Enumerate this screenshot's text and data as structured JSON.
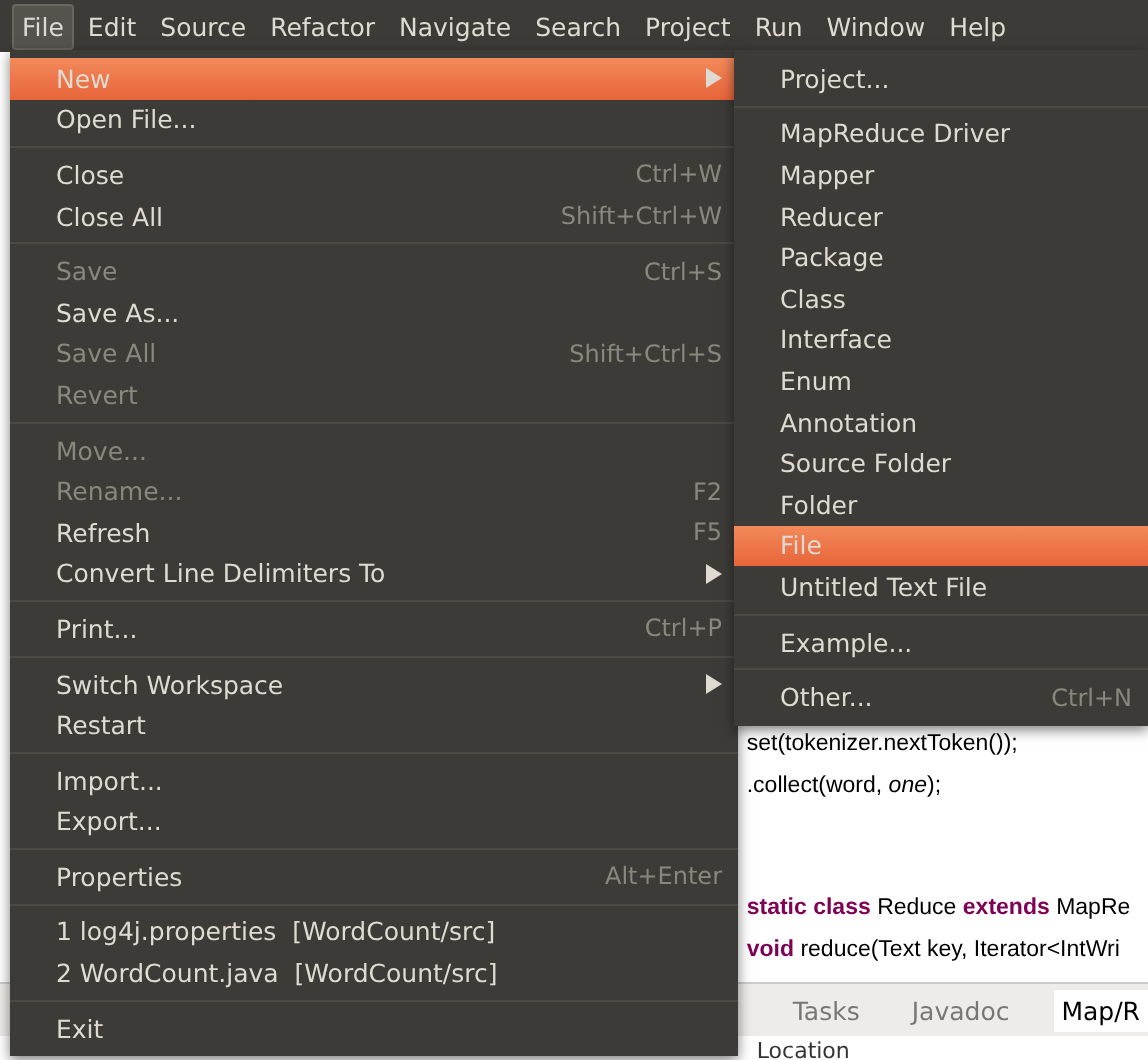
{
  "menubar": [
    {
      "label": "File",
      "selected": true
    },
    {
      "label": "Edit",
      "selected": false
    },
    {
      "label": "Source",
      "selected": false
    },
    {
      "label": "Refactor",
      "selected": false
    },
    {
      "label": "Navigate",
      "selected": false
    },
    {
      "label": "Search",
      "selected": false
    },
    {
      "label": "Project",
      "selected": false
    },
    {
      "label": "Run",
      "selected": false
    },
    {
      "label": "Window",
      "selected": false
    },
    {
      "label": "Help",
      "selected": false
    }
  ],
  "file_menu": [
    {
      "kind": "item",
      "label": "New",
      "selected": true,
      "disabled": false,
      "submenu": true
    },
    {
      "kind": "item",
      "label": "Open File...",
      "selected": false,
      "disabled": false,
      "submenu": false
    },
    {
      "kind": "separator"
    },
    {
      "kind": "item",
      "label": "Close",
      "shortcut": "Ctrl+W",
      "selected": false,
      "disabled": false,
      "submenu": false
    },
    {
      "kind": "item",
      "label": "Close All",
      "shortcut": "Shift+Ctrl+W",
      "selected": false,
      "disabled": false,
      "submenu": false
    },
    {
      "kind": "separator"
    },
    {
      "kind": "item",
      "label": "Save",
      "shortcut": "Ctrl+S",
      "selected": false,
      "disabled": true,
      "submenu": false
    },
    {
      "kind": "item",
      "label": "Save As...",
      "selected": false,
      "disabled": false,
      "submenu": false
    },
    {
      "kind": "item",
      "label": "Save All",
      "shortcut": "Shift+Ctrl+S",
      "selected": false,
      "disabled": true,
      "submenu": false
    },
    {
      "kind": "item",
      "label": "Revert",
      "selected": false,
      "disabled": true,
      "submenu": false
    },
    {
      "kind": "separator"
    },
    {
      "kind": "item",
      "label": "Move...",
      "selected": false,
      "disabled": true,
      "submenu": false
    },
    {
      "kind": "item",
      "label": "Rename...",
      "shortcut": "F2",
      "selected": false,
      "disabled": true,
      "submenu": false
    },
    {
      "kind": "item",
      "label": "Refresh",
      "shortcut": "F5",
      "selected": false,
      "disabled": false,
      "submenu": false
    },
    {
      "kind": "item",
      "label": "Convert Line Delimiters To",
      "selected": false,
      "disabled": false,
      "submenu": true
    },
    {
      "kind": "separator"
    },
    {
      "kind": "item",
      "label": "Print...",
      "shortcut": "Ctrl+P",
      "selected": false,
      "disabled": false,
      "submenu": false
    },
    {
      "kind": "separator"
    },
    {
      "kind": "item",
      "label": "Switch Workspace",
      "selected": false,
      "disabled": false,
      "submenu": true
    },
    {
      "kind": "item",
      "label": "Restart",
      "selected": false,
      "disabled": false,
      "submenu": false
    },
    {
      "kind": "separator"
    },
    {
      "kind": "item",
      "label": "Import...",
      "selected": false,
      "disabled": false,
      "submenu": false
    },
    {
      "kind": "item",
      "label": "Export...",
      "selected": false,
      "disabled": false,
      "submenu": false
    },
    {
      "kind": "separator"
    },
    {
      "kind": "item",
      "label": "Properties",
      "shortcut": "Alt+Enter",
      "selected": false,
      "disabled": false,
      "submenu": false
    },
    {
      "kind": "separator"
    },
    {
      "kind": "item",
      "label": "1 log4j.properties  [WordCount/src]",
      "selected": false,
      "disabled": false,
      "submenu": false
    },
    {
      "kind": "item",
      "label": "2 WordCount.java  [WordCount/src]",
      "selected": false,
      "disabled": false,
      "submenu": false
    },
    {
      "kind": "separator"
    },
    {
      "kind": "item",
      "label": "Exit",
      "selected": false,
      "disabled": false,
      "submenu": false
    }
  ],
  "new_submenu": [
    {
      "kind": "item",
      "label": "Project...",
      "selected": false
    },
    {
      "kind": "separator"
    },
    {
      "kind": "item",
      "label": "MapReduce Driver",
      "selected": false
    },
    {
      "kind": "item",
      "label": "Mapper",
      "selected": false
    },
    {
      "kind": "item",
      "label": "Reducer",
      "selected": false
    },
    {
      "kind": "item",
      "label": "Package",
      "selected": false
    },
    {
      "kind": "item",
      "label": "Class",
      "selected": false
    },
    {
      "kind": "item",
      "label": "Interface",
      "selected": false
    },
    {
      "kind": "item",
      "label": "Enum",
      "selected": false
    },
    {
      "kind": "item",
      "label": "Annotation",
      "selected": false
    },
    {
      "kind": "item",
      "label": "Source Folder",
      "selected": false
    },
    {
      "kind": "item",
      "label": "Folder",
      "selected": false
    },
    {
      "kind": "item",
      "label": "File",
      "selected": true
    },
    {
      "kind": "item",
      "label": "Untitled Text File",
      "selected": false
    },
    {
      "kind": "separator"
    },
    {
      "kind": "item",
      "label": "Example...",
      "selected": false
    },
    {
      "kind": "separator"
    },
    {
      "kind": "item",
      "label": "Other...",
      "shortcut": "Ctrl+N",
      "selected": false
    }
  ],
  "editor": {
    "code_lines": [
      {
        "kind": "plain",
        "text": "set(tokenizer.nextToken());"
      },
      {
        "kind": "plain",
        "text": ".collect(word, *one*);"
      },
      {
        "kind": "blank"
      },
      {
        "kind": "blank"
      },
      {
        "kind": "plain",
        "text": "**static class** Reduce **extends** MapRe"
      },
      {
        "kind": "plain",
        "text": "**void** reduce(Text key, Iterator<IntWri"
      }
    ]
  },
  "bottom_tabs": [
    {
      "label": "Tasks",
      "selected": false
    },
    {
      "label": "Javadoc",
      "selected": false
    },
    {
      "label": "Map/R",
      "selected": true
    }
  ],
  "bottom_header": "Location"
}
